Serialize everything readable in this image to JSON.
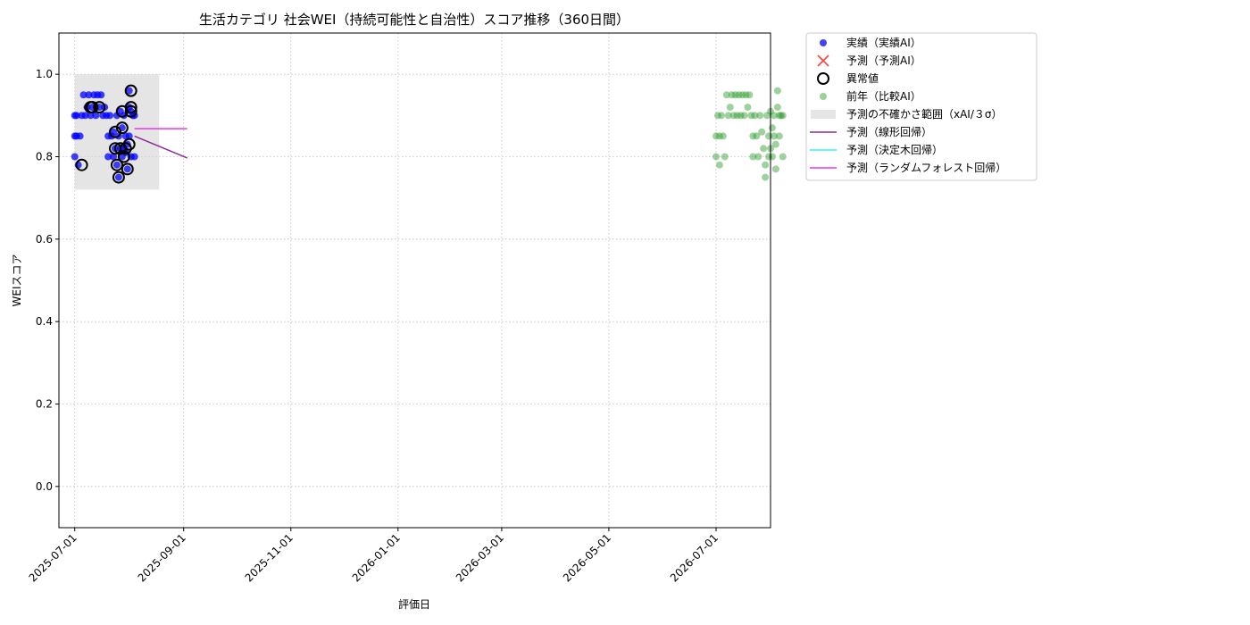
{
  "chart_data": {
    "type": "scatter",
    "title": "生活カテゴリ 社会WEI（持続可能性と自治性）スコア推移（360日間）",
    "xlabel": "評価日",
    "ylabel": "WEIスコア",
    "xlim": [
      "2025-06-22",
      "2026-08-01"
    ],
    "ylim": [
      -0.1,
      1.1
    ],
    "x_ticks": [
      "2025-07-01",
      "2025-09-01",
      "2025-11-01",
      "2026-01-01",
      "2026-03-01",
      "2026-05-01",
      "2026-07-01"
    ],
    "y_ticks": [
      "0.0",
      "0.2",
      "0.4",
      "0.6",
      "0.8",
      "1.0"
    ],
    "grid": true,
    "legend_position": "outside-upper-right",
    "legend": [
      {
        "label": "実績（実績AI）",
        "kind": "dot",
        "color": "#2323e6"
      },
      {
        "label": "予測（予測AI）",
        "kind": "cross",
        "color": "#ff4040"
      },
      {
        "label": "異常値",
        "kind": "ring",
        "color": "#000000"
      },
      {
        "label": "前年（比較AI）",
        "kind": "dot-faint",
        "color": "#3aa43a"
      },
      {
        "label": "予測の不確かさ範囲（xAI/３σ）",
        "kind": "patch",
        "color": "#d3d3d3"
      },
      {
        "label": "予測（線形回帰）",
        "kind": "line",
        "color": "#8b2a9a"
      },
      {
        "label": "予測（決定木回帰）",
        "kind": "line",
        "color": "#33f0f0"
      },
      {
        "label": "予測（ランダムフォレスト回帰）",
        "kind": "line",
        "color": "#ee33ee"
      }
    ],
    "uncertainty_band": {
      "x_start": "2025-07-01",
      "x_end": "2025-08-18",
      "y_low": 0.72,
      "y_high": 1.0,
      "color": "#d3d3d3"
    },
    "series": [
      {
        "name": "実績（実績AI）",
        "kind": "scatter",
        "color": "#0000ff",
        "points": [
          [
            "2025-07-01",
            0.9
          ],
          [
            "2025-07-01",
            0.85
          ],
          [
            "2025-07-01",
            0.8
          ],
          [
            "2025-07-02",
            0.9
          ],
          [
            "2025-07-02",
            0.85
          ],
          [
            "2025-07-03",
            0.78
          ],
          [
            "2025-07-04",
            0.85
          ],
          [
            "2025-07-05",
            0.9
          ],
          [
            "2025-07-06",
            0.95
          ],
          [
            "2025-07-07",
            0.9
          ],
          [
            "2025-07-08",
            0.92
          ],
          [
            "2025-07-09",
            0.95
          ],
          [
            "2025-07-10",
            0.9
          ],
          [
            "2025-07-11",
            0.92
          ],
          [
            "2025-07-12",
            0.95
          ],
          [
            "2025-07-13",
            0.9
          ],
          [
            "2025-07-14",
            0.95
          ],
          [
            "2025-07-15",
            0.92
          ],
          [
            "2025-07-16",
            0.95
          ],
          [
            "2025-07-17",
            0.9
          ],
          [
            "2025-07-18",
            0.92
          ],
          [
            "2025-07-19",
            0.9
          ],
          [
            "2025-07-20",
            0.85
          ],
          [
            "2025-07-20",
            0.8
          ],
          [
            "2025-07-21",
            0.9
          ],
          [
            "2025-07-22",
            0.85
          ],
          [
            "2025-07-23",
            0.8
          ],
          [
            "2025-07-23",
            0.86
          ],
          [
            "2025-07-24",
            0.82
          ],
          [
            "2025-07-25",
            0.9
          ],
          [
            "2025-07-25",
            0.78
          ],
          [
            "2025-07-26",
            0.75
          ],
          [
            "2025-07-26",
            0.85
          ],
          [
            "2025-07-27",
            0.82
          ],
          [
            "2025-07-27",
            0.91
          ],
          [
            "2025-07-28",
            0.87
          ],
          [
            "2025-07-28",
            0.8
          ],
          [
            "2025-07-29",
            0.82
          ],
          [
            "2025-07-29",
            0.9
          ],
          [
            "2025-07-30",
            0.81
          ],
          [
            "2025-07-30",
            0.85
          ],
          [
            "2025-07-31",
            0.77
          ],
          [
            "2025-07-31",
            0.83
          ],
          [
            "2025-08-01",
            0.92
          ],
          [
            "2025-08-01",
            0.96
          ],
          [
            "2025-08-01",
            0.85
          ],
          [
            "2025-08-02",
            0.91
          ],
          [
            "2025-08-02",
            0.8
          ],
          [
            "2025-08-03",
            0.9
          ],
          [
            "2025-08-04",
            0.8
          ],
          [
            "2025-08-04",
            0.9
          ]
        ]
      },
      {
        "name": "異常値",
        "kind": "ring",
        "color": "#000000",
        "points": [
          [
            "2025-07-05",
            0.78
          ],
          [
            "2025-07-10",
            0.92
          ],
          [
            "2025-07-11",
            0.92
          ],
          [
            "2025-07-15",
            0.92
          ],
          [
            "2025-07-24",
            0.82
          ],
          [
            "2025-07-24",
            0.86
          ],
          [
            "2025-07-25",
            0.78
          ],
          [
            "2025-07-26",
            0.75
          ],
          [
            "2025-07-27",
            0.82
          ],
          [
            "2025-07-28",
            0.91
          ],
          [
            "2025-07-28",
            0.87
          ],
          [
            "2025-07-29",
            0.8
          ],
          [
            "2025-07-30",
            0.82
          ],
          [
            "2025-07-31",
            0.77
          ],
          [
            "2025-08-01",
            0.83
          ],
          [
            "2025-08-02",
            0.96
          ],
          [
            "2025-08-02",
            0.92
          ],
          [
            "2025-08-02",
            0.91
          ]
        ]
      },
      {
        "name": "前年（比較AI）",
        "kind": "scatter-faint",
        "color": "#2a9a2a",
        "points": [
          [
            "2026-07-01",
            0.8
          ],
          [
            "2026-07-01",
            0.85
          ],
          [
            "2026-07-02",
            0.9
          ],
          [
            "2026-07-03",
            0.85
          ],
          [
            "2026-07-03",
            0.78
          ],
          [
            "2026-07-04",
            0.9
          ],
          [
            "2026-07-05",
            0.85
          ],
          [
            "2026-07-06",
            0.8
          ],
          [
            "2026-07-07",
            0.95
          ],
          [
            "2026-07-08",
            0.9
          ],
          [
            "2026-07-09",
            0.92
          ],
          [
            "2026-07-10",
            0.95
          ],
          [
            "2026-07-11",
            0.9
          ],
          [
            "2026-07-12",
            0.95
          ],
          [
            "2026-07-13",
            0.9
          ],
          [
            "2026-07-14",
            0.95
          ],
          [
            "2026-07-15",
            0.9
          ],
          [
            "2026-07-16",
            0.95
          ],
          [
            "2026-07-17",
            0.9
          ],
          [
            "2026-07-18",
            0.95
          ],
          [
            "2026-07-19",
            0.92
          ],
          [
            "2026-07-20",
            0.95
          ],
          [
            "2026-07-21",
            0.9
          ],
          [
            "2026-07-22",
            0.85
          ],
          [
            "2026-07-22",
            0.8
          ],
          [
            "2026-07-23",
            0.9
          ],
          [
            "2026-07-24",
            0.85
          ],
          [
            "2026-07-25",
            0.8
          ],
          [
            "2026-07-26",
            0.9
          ],
          [
            "2026-07-27",
            0.86
          ],
          [
            "2026-07-28",
            0.82
          ],
          [
            "2026-07-29",
            0.75
          ],
          [
            "2026-07-29",
            0.78
          ],
          [
            "2026-07-30",
            0.9
          ],
          [
            "2026-07-31",
            0.85
          ],
          [
            "2026-07-31",
            0.8
          ],
          [
            "2026-08-01",
            0.91
          ],
          [
            "2026-08-01",
            0.82
          ],
          [
            "2026-08-02",
            0.87
          ],
          [
            "2026-08-02",
            0.8
          ],
          [
            "2026-08-03",
            0.9
          ],
          [
            "2026-08-03",
            0.85
          ],
          [
            "2026-08-04",
            0.77
          ],
          [
            "2026-08-04",
            0.83
          ],
          [
            "2026-08-05",
            0.96
          ],
          [
            "2026-08-05",
            0.92
          ],
          [
            "2026-08-06",
            0.85
          ],
          [
            "2026-08-06",
            0.9
          ],
          [
            "2026-08-07",
            0.9
          ],
          [
            "2026-08-08",
            0.8
          ],
          [
            "2026-08-08",
            0.9
          ]
        ]
      },
      {
        "name": "予測（線形回帰）",
        "kind": "line",
        "color": "#8b2a9a",
        "points": [
          [
            "2025-08-04",
            0.85
          ],
          [
            "2025-09-03",
            0.797
          ]
        ]
      },
      {
        "name": "予測（ランダムフォレスト回帰）",
        "kind": "line",
        "color": "#ee33ee",
        "points": [
          [
            "2025-08-04",
            0.868
          ],
          [
            "2025-09-03",
            0.868
          ]
        ]
      }
    ]
  }
}
